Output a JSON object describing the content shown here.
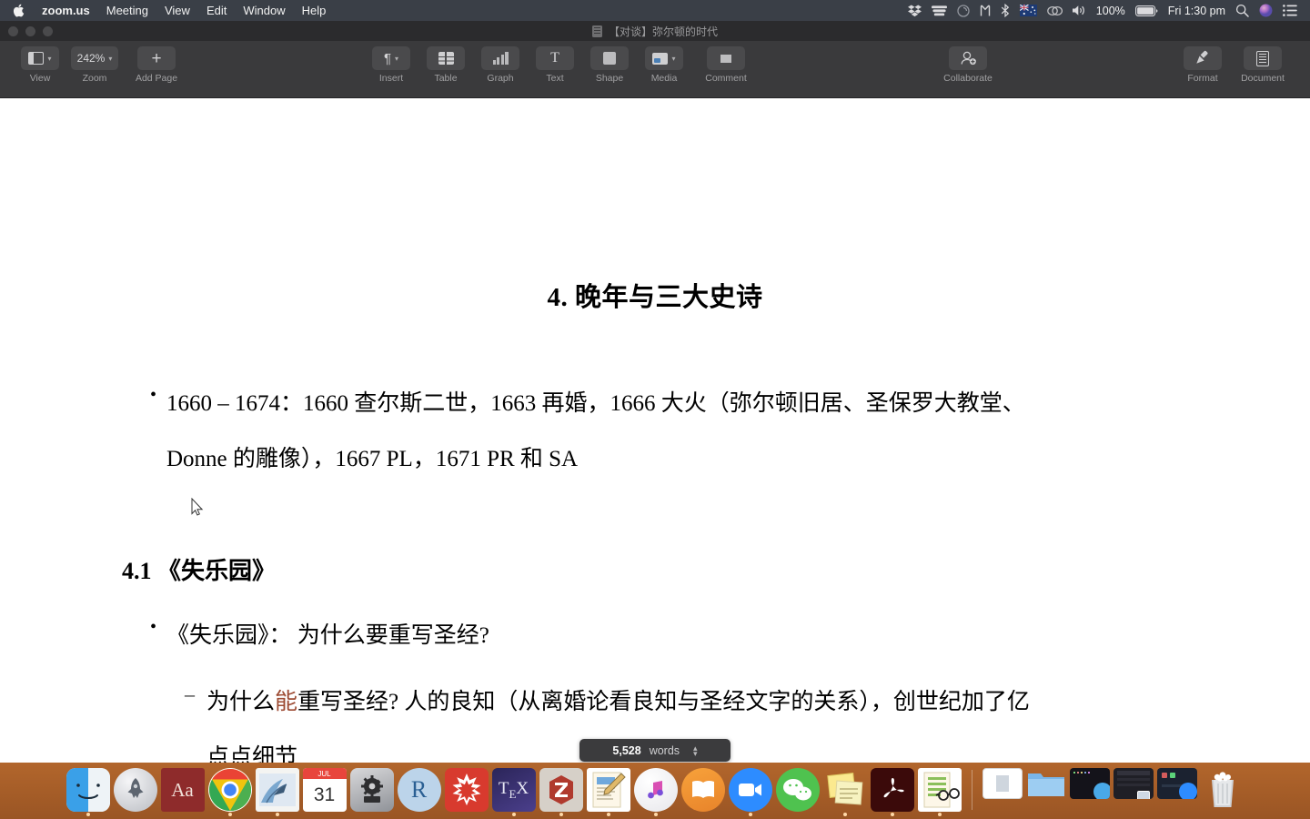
{
  "menubar": {
    "apple": "",
    "items": [
      "zoom.us",
      "Meeting",
      "View",
      "Edit",
      "Window",
      "Help"
    ],
    "status": {
      "dropbox": "dropbox-icon",
      "backup": "backup-icon",
      "sync": "sync-icon",
      "app_m": "m-app-icon",
      "bluetooth": "bluetooth-icon",
      "flag": "australia-flag-icon",
      "vpn": "vpn-icon",
      "volume": "volume-icon",
      "battery_pct": "100%",
      "clock": "Fri 1:30 pm",
      "search": "search-icon",
      "siri": "siri-icon",
      "controlcenter": "list-icon"
    }
  },
  "window": {
    "title": "【对谈】弥尔顿的时代",
    "toolbar": {
      "left": [
        {
          "label": "View",
          "icon": "view-panel-icon",
          "has_chevron": true
        },
        {
          "label": "Zoom",
          "icon": "zoom-value",
          "value": "242%",
          "has_chevron": true
        },
        {
          "label": "Add Page",
          "icon": "plus-icon",
          "has_chevron": false
        }
      ],
      "center": [
        {
          "label": "Insert",
          "icon": "pilcrow-icon",
          "has_chevron": true
        },
        {
          "label": "Table",
          "icon": "table-icon",
          "has_chevron": false
        },
        {
          "label": "Graph",
          "icon": "graph-icon",
          "has_chevron": false
        },
        {
          "label": "Text",
          "icon": "text-icon",
          "has_chevron": false
        },
        {
          "label": "Shape",
          "icon": "shape-icon",
          "has_chevron": false
        },
        {
          "label": "Media",
          "icon": "media-icon",
          "has_chevron": true
        },
        {
          "label": "Comment",
          "icon": "comment-icon",
          "has_chevron": false
        }
      ],
      "collaborate": {
        "label": "Collaborate",
        "icon": "collaborate-icon"
      },
      "right": [
        {
          "label": "Format",
          "icon": "format-brush-icon"
        },
        {
          "label": "Document",
          "icon": "document-icon"
        }
      ]
    }
  },
  "document": {
    "heading": "4. 晚年与三大史诗",
    "bullet1_line1": "1660 – 1674：1660 查尔斯二世，1663 再婚，1666 大火（弥尔顿旧居、圣保罗大教堂、",
    "bullet1_line2": "Donne 的雕像），1667 PL，1671 PR 和 SA",
    "subheading": "4.1 《失乐园》",
    "bullet2": "《失乐园》： 为什么要重写圣经?",
    "sub1_part1": "为什么",
    "sub1_highlight": "能",
    "sub1_part2": "重写圣经? 人的良知（从离婚论看良知与圣经文字的关系），创世纪加了亿",
    "sub1_line2": "点点细节"
  },
  "wordcount": {
    "number": "5,528",
    "unit": "words"
  },
  "dock": {
    "items": [
      {
        "name": "finder",
        "label": "Finder",
        "running": true
      },
      {
        "name": "launchpad",
        "label": "Launchpad",
        "running": false
      },
      {
        "name": "dictionary",
        "label": "Dictionary",
        "running": false
      },
      {
        "name": "chrome",
        "label": "Google Chrome",
        "running": true
      },
      {
        "name": "mail",
        "label": "Mail",
        "running": true
      },
      {
        "name": "calendar",
        "label": "Calendar",
        "running": false
      },
      {
        "name": "system-preferences",
        "label": "System Preferences",
        "running": false
      },
      {
        "name": "rstudio",
        "label": "RStudio",
        "running": false
      },
      {
        "name": "mathematica",
        "label": "Mathematica",
        "running": false
      },
      {
        "name": "texshop",
        "label": "TeXShop",
        "running": true
      },
      {
        "name": "zotero",
        "label": "Zotero",
        "running": true
      },
      {
        "name": "pages",
        "label": "Pages",
        "running": true
      },
      {
        "name": "itunes",
        "label": "iTunes",
        "running": true
      },
      {
        "name": "books",
        "label": "Books",
        "running": false
      },
      {
        "name": "zoom",
        "label": "zoom.us",
        "running": true
      },
      {
        "name": "wechat",
        "label": "WeChat",
        "running": false
      },
      {
        "name": "stickies",
        "label": "Stickies",
        "running": true
      },
      {
        "name": "acrobat",
        "label": "Adobe Acrobat",
        "running": true
      },
      {
        "name": "preview",
        "label": "Preview",
        "running": true
      }
    ],
    "minimized": [
      {
        "name": "minimized-document",
        "label": "document-window"
      },
      {
        "name": "minimized-folder",
        "label": "folder-window"
      },
      {
        "name": "minimized-terminal",
        "label": "terminal-window"
      },
      {
        "name": "minimized-photos",
        "label": "photos-window"
      },
      {
        "name": "minimized-zoom",
        "label": "zoom-window"
      }
    ],
    "trash": {
      "name": "trash",
      "label": "Trash"
    }
  },
  "colors": {
    "menubar": "#3a3f48",
    "toolbar": "#3a3a3c",
    "dock": "#a85f28",
    "highlight_text": "#9c4a32",
    "accent_blue": "#3aa0e8"
  }
}
